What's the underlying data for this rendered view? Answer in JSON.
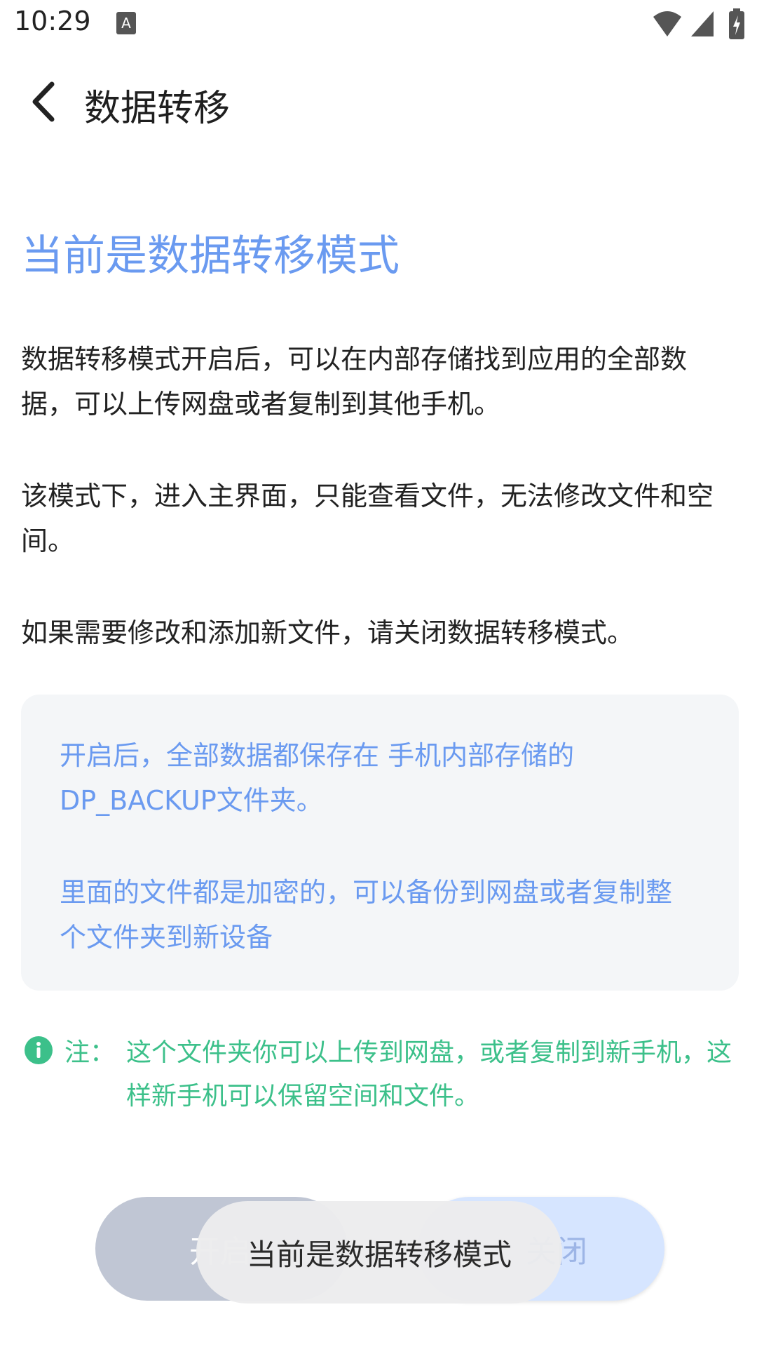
{
  "status_bar": {
    "time": "10:29",
    "notification_icon": "a-letter-notification-icon",
    "wifi_icon": "wifi-icon",
    "signal_icon": "cell-signal-icon",
    "battery_icon": "battery-charging-icon"
  },
  "app_bar": {
    "back_icon": "chevron-left-icon",
    "title": "数据转移"
  },
  "mode_title": "当前是数据转移模式",
  "paragraphs": {
    "p1": "数据转移模式开启后，可以在内部存储找到应用的全部数据，可以上传网盘或者复制到其他手机。",
    "p2": "该模式下，进入主界面，只能查看文件，无法修改文件和空间。",
    "p3": "如果需要修改和添加新文件，请关闭数据转移模式。"
  },
  "info_box": {
    "text1": "开启后，全部数据都保存在 手机内部存储的DP_BACKUP文件夹。",
    "text2": "里面的文件都是加密的，可以备份到网盘或者复制整个文件夹到新设备"
  },
  "note": {
    "icon": "info-icon",
    "label": "注：",
    "text": "这个文件夹你可以上传到网盘，或者复制到新手机，这样新手机可以保留空间和文件。"
  },
  "buttons": {
    "open_label": "开启",
    "close_label": "关闭"
  },
  "toast": {
    "message": "当前是数据转移模式"
  },
  "colors": {
    "accent_blue": "#6a9af0",
    "note_green": "#3cc08a",
    "info_bg": "#f4f6f8",
    "open_button_bg": "#c0c6d4",
    "close_button_bg": "#d6e5ff"
  }
}
